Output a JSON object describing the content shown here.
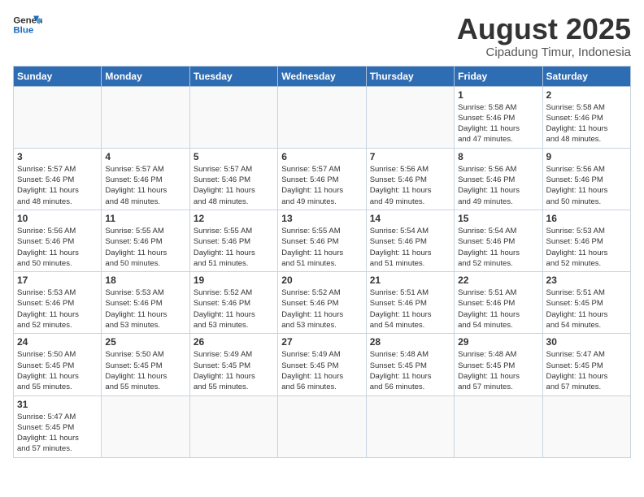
{
  "header": {
    "logo_general": "General",
    "logo_blue": "Blue",
    "title": "August 2025",
    "subtitle": "Cipadung Timur, Indonesia"
  },
  "weekdays": [
    "Sunday",
    "Monday",
    "Tuesday",
    "Wednesday",
    "Thursday",
    "Friday",
    "Saturday"
  ],
  "weeks": [
    [
      {
        "day": "",
        "info": ""
      },
      {
        "day": "",
        "info": ""
      },
      {
        "day": "",
        "info": ""
      },
      {
        "day": "",
        "info": ""
      },
      {
        "day": "",
        "info": ""
      },
      {
        "day": "1",
        "info": "Sunrise: 5:58 AM\nSunset: 5:46 PM\nDaylight: 11 hours\nand 47 minutes."
      },
      {
        "day": "2",
        "info": "Sunrise: 5:58 AM\nSunset: 5:46 PM\nDaylight: 11 hours\nand 48 minutes."
      }
    ],
    [
      {
        "day": "3",
        "info": "Sunrise: 5:57 AM\nSunset: 5:46 PM\nDaylight: 11 hours\nand 48 minutes."
      },
      {
        "day": "4",
        "info": "Sunrise: 5:57 AM\nSunset: 5:46 PM\nDaylight: 11 hours\nand 48 minutes."
      },
      {
        "day": "5",
        "info": "Sunrise: 5:57 AM\nSunset: 5:46 PM\nDaylight: 11 hours\nand 48 minutes."
      },
      {
        "day": "6",
        "info": "Sunrise: 5:57 AM\nSunset: 5:46 PM\nDaylight: 11 hours\nand 49 minutes."
      },
      {
        "day": "7",
        "info": "Sunrise: 5:56 AM\nSunset: 5:46 PM\nDaylight: 11 hours\nand 49 minutes."
      },
      {
        "day": "8",
        "info": "Sunrise: 5:56 AM\nSunset: 5:46 PM\nDaylight: 11 hours\nand 49 minutes."
      },
      {
        "day": "9",
        "info": "Sunrise: 5:56 AM\nSunset: 5:46 PM\nDaylight: 11 hours\nand 50 minutes."
      }
    ],
    [
      {
        "day": "10",
        "info": "Sunrise: 5:56 AM\nSunset: 5:46 PM\nDaylight: 11 hours\nand 50 minutes."
      },
      {
        "day": "11",
        "info": "Sunrise: 5:55 AM\nSunset: 5:46 PM\nDaylight: 11 hours\nand 50 minutes."
      },
      {
        "day": "12",
        "info": "Sunrise: 5:55 AM\nSunset: 5:46 PM\nDaylight: 11 hours\nand 51 minutes."
      },
      {
        "day": "13",
        "info": "Sunrise: 5:55 AM\nSunset: 5:46 PM\nDaylight: 11 hours\nand 51 minutes."
      },
      {
        "day": "14",
        "info": "Sunrise: 5:54 AM\nSunset: 5:46 PM\nDaylight: 11 hours\nand 51 minutes."
      },
      {
        "day": "15",
        "info": "Sunrise: 5:54 AM\nSunset: 5:46 PM\nDaylight: 11 hours\nand 52 minutes."
      },
      {
        "day": "16",
        "info": "Sunrise: 5:53 AM\nSunset: 5:46 PM\nDaylight: 11 hours\nand 52 minutes."
      }
    ],
    [
      {
        "day": "17",
        "info": "Sunrise: 5:53 AM\nSunset: 5:46 PM\nDaylight: 11 hours\nand 52 minutes."
      },
      {
        "day": "18",
        "info": "Sunrise: 5:53 AM\nSunset: 5:46 PM\nDaylight: 11 hours\nand 53 minutes."
      },
      {
        "day": "19",
        "info": "Sunrise: 5:52 AM\nSunset: 5:46 PM\nDaylight: 11 hours\nand 53 minutes."
      },
      {
        "day": "20",
        "info": "Sunrise: 5:52 AM\nSunset: 5:46 PM\nDaylight: 11 hours\nand 53 minutes."
      },
      {
        "day": "21",
        "info": "Sunrise: 5:51 AM\nSunset: 5:46 PM\nDaylight: 11 hours\nand 54 minutes."
      },
      {
        "day": "22",
        "info": "Sunrise: 5:51 AM\nSunset: 5:46 PM\nDaylight: 11 hours\nand 54 minutes."
      },
      {
        "day": "23",
        "info": "Sunrise: 5:51 AM\nSunset: 5:45 PM\nDaylight: 11 hours\nand 54 minutes."
      }
    ],
    [
      {
        "day": "24",
        "info": "Sunrise: 5:50 AM\nSunset: 5:45 PM\nDaylight: 11 hours\nand 55 minutes."
      },
      {
        "day": "25",
        "info": "Sunrise: 5:50 AM\nSunset: 5:45 PM\nDaylight: 11 hours\nand 55 minutes."
      },
      {
        "day": "26",
        "info": "Sunrise: 5:49 AM\nSunset: 5:45 PM\nDaylight: 11 hours\nand 55 minutes."
      },
      {
        "day": "27",
        "info": "Sunrise: 5:49 AM\nSunset: 5:45 PM\nDaylight: 11 hours\nand 56 minutes."
      },
      {
        "day": "28",
        "info": "Sunrise: 5:48 AM\nSunset: 5:45 PM\nDaylight: 11 hours\nand 56 minutes."
      },
      {
        "day": "29",
        "info": "Sunrise: 5:48 AM\nSunset: 5:45 PM\nDaylight: 11 hours\nand 57 minutes."
      },
      {
        "day": "30",
        "info": "Sunrise: 5:47 AM\nSunset: 5:45 PM\nDaylight: 11 hours\nand 57 minutes."
      }
    ],
    [
      {
        "day": "31",
        "info": "Sunrise: 5:47 AM\nSunset: 5:45 PM\nDaylight: 11 hours\nand 57 minutes."
      },
      {
        "day": "",
        "info": ""
      },
      {
        "day": "",
        "info": ""
      },
      {
        "day": "",
        "info": ""
      },
      {
        "day": "",
        "info": ""
      },
      {
        "day": "",
        "info": ""
      },
      {
        "day": "",
        "info": ""
      }
    ]
  ]
}
